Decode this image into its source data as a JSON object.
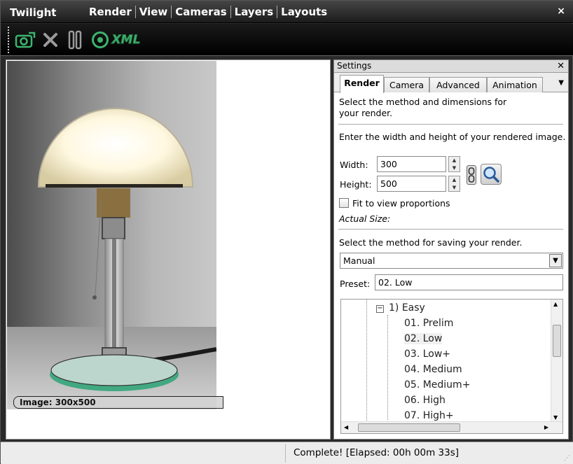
{
  "app": {
    "title": "Twilight",
    "close_glyph": "×"
  },
  "menu": [
    "Render",
    "View",
    "Cameras",
    "Layers",
    "Layouts"
  ],
  "toolbar": {
    "items": [
      {
        "name": "render-camera-icon"
      },
      {
        "name": "cancel-x-icon"
      },
      {
        "name": "pause-icon"
      },
      {
        "name": "record-icon"
      },
      {
        "name": "xml-icon",
        "label": "XML"
      }
    ],
    "accent": "#3cb46e"
  },
  "viewport": {
    "image_label": "Image: 300x500"
  },
  "settings": {
    "title": "Settings",
    "close_glyph": "✕",
    "tabs": [
      "Render",
      "Camera",
      "Advanced",
      "Animation"
    ],
    "intro": "Select the method and dimensions for your render.",
    "dims_prompt": "Enter the width and height of your rendered image.",
    "width_label": "Width:",
    "width_value": "300",
    "height_label": "Height:",
    "height_value": "500",
    "fit_label": "Fit to view proportions",
    "actual_size_label": "Actual Size:",
    "save_prompt": "Select the method for saving your render.",
    "save_method": "Manual",
    "preset_label": "Preset:",
    "preset_value": "02. Low",
    "tree": {
      "group": "1) Easy",
      "items": [
        "01. Prelim",
        "02. Low",
        "03. Low+",
        "04. Medium",
        "05. Medium+",
        "06. High",
        "07. High+"
      ],
      "selected": "02. Low"
    }
  },
  "status": {
    "text": "Complete!  [Elapsed: 00h 00m 33s]"
  }
}
